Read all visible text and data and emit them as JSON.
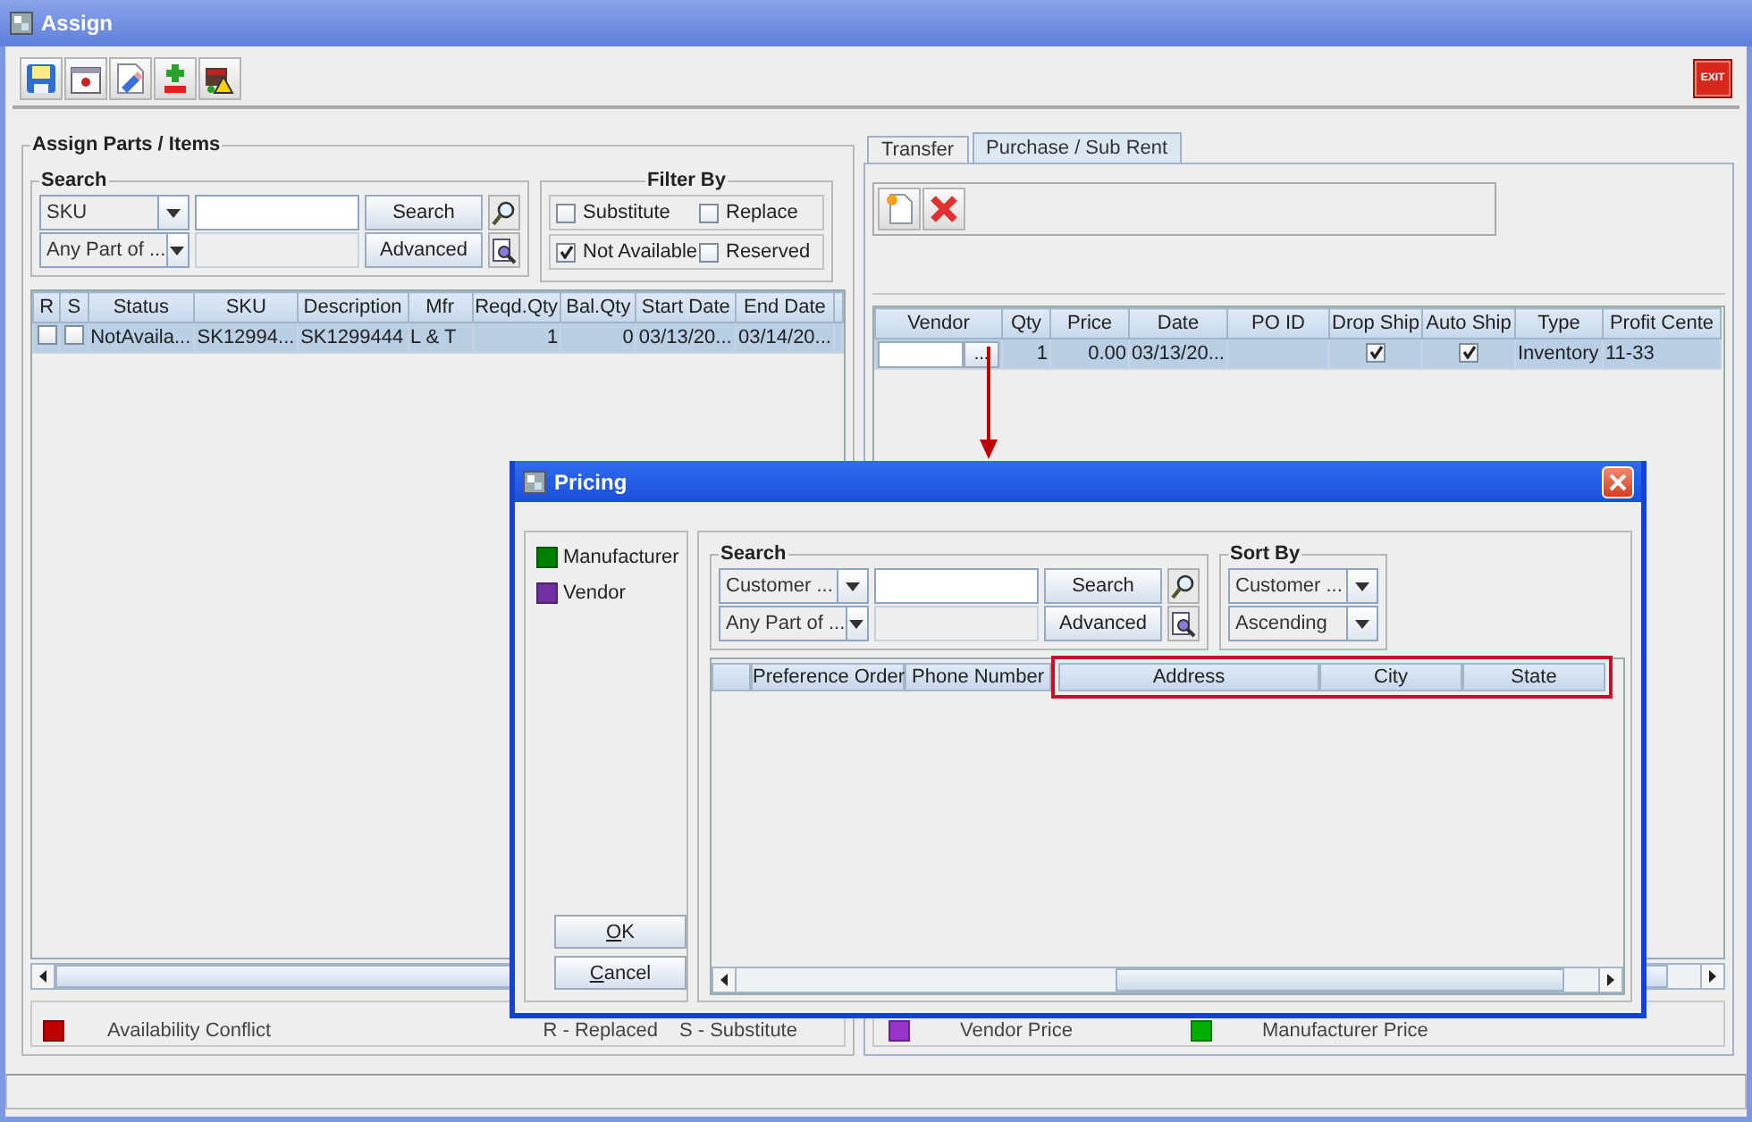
{
  "window": {
    "title": "Assign"
  },
  "toolbar": {
    "exit_label": "EXIT"
  },
  "assign_panel": {
    "title": "Assign Parts / Items",
    "search": {
      "title": "Search",
      "field_choice": "SKU",
      "match_choice": "Any Part of ...",
      "search_button": "Search",
      "advanced_button": "Advanced"
    },
    "filter": {
      "title": "Filter By",
      "options": [
        {
          "label": "Substitute",
          "checked": false
        },
        {
          "label": "Replace",
          "checked": false
        },
        {
          "label": "Not Available",
          "checked": true
        },
        {
          "label": "Reserved",
          "checked": false
        }
      ]
    },
    "table": {
      "columns": [
        "R",
        "S",
        "Status",
        "SKU",
        "Description",
        "Mfr",
        "Reqd.Qty",
        "Bal.Qty",
        "Start Date",
        "End Date"
      ],
      "rows": [
        {
          "selected": true,
          "cells": [
            {
              "kind": "check",
              "checked": false
            },
            {
              "kind": "check",
              "checked": false
            },
            {
              "kind": "text",
              "text": "NotAvaila..."
            },
            {
              "kind": "text",
              "text": "SK12994..."
            },
            {
              "kind": "text",
              "text": "SK1299444"
            },
            {
              "kind": "text",
              "text": "L & T"
            },
            {
              "kind": "number",
              "text": "1"
            },
            {
              "kind": "number",
              "text": "0"
            },
            {
              "kind": "text",
              "text": "03/13/20..."
            },
            {
              "kind": "text",
              "text": "03/14/20..."
            }
          ]
        }
      ]
    },
    "legend": {
      "label": "Availability Conflict",
      "color": "#c00000"
    },
    "key": [
      "R - Replaced",
      "S - Substitute"
    ]
  },
  "transfer_panel": {
    "tabs": [
      {
        "label": "Transfer",
        "selected": false
      },
      {
        "label": "Purchase / Sub Rent",
        "selected": true
      }
    ],
    "table": {
      "columns": [
        "Vendor",
        "Qty",
        "Price",
        "Date",
        "PO ID",
        "Drop Ship",
        "Auto Ship",
        "Type",
        "Profit Cente"
      ],
      "rows": [
        {
          "selected": true,
          "cells": [
            {
              "kind": "vendor",
              "button": "..."
            },
            {
              "kind": "number",
              "text": "1"
            },
            {
              "kind": "number",
              "text": "0.00"
            },
            {
              "kind": "text",
              "text": "03/13/20..."
            },
            {
              "kind": "empty"
            },
            {
              "kind": "check",
              "checked": true
            },
            {
              "kind": "check",
              "checked": true
            },
            {
              "kind": "text",
              "text": "Inventory"
            },
            {
              "kind": "text",
              "text": "11-33"
            }
          ]
        }
      ]
    },
    "legend": [
      {
        "label": "Vendor Price",
        "color": "#9933cc"
      },
      {
        "label": "Manufacturer Price",
        "color": "#00b000"
      }
    ]
  },
  "pricing_dialog": {
    "title": "Pricing",
    "legend": [
      {
        "label": "Manufacturer",
        "color": "#008000"
      },
      {
        "label": "Vendor",
        "color": "#7030a0"
      }
    ],
    "buttons": [
      "OK",
      "Cancel"
    ],
    "search": {
      "title": "Search",
      "field_choice": "Customer ...",
      "match_choice": "Any Part of ...",
      "search_button": "Search",
      "advanced_button": "Advanced"
    },
    "sort": {
      "title": "Sort By",
      "field_choice": "Customer ...",
      "order_choice": "Ascending"
    },
    "table": {
      "columns": [
        {
          "label": "Preference Order",
          "highlighted": false
        },
        {
          "label": "Phone Number",
          "highlighted": false
        },
        {
          "label": "Address",
          "highlighted": true
        },
        {
          "label": "City",
          "highlighted": true
        },
        {
          "label": "State",
          "highlighted": true
        }
      ]
    }
  }
}
